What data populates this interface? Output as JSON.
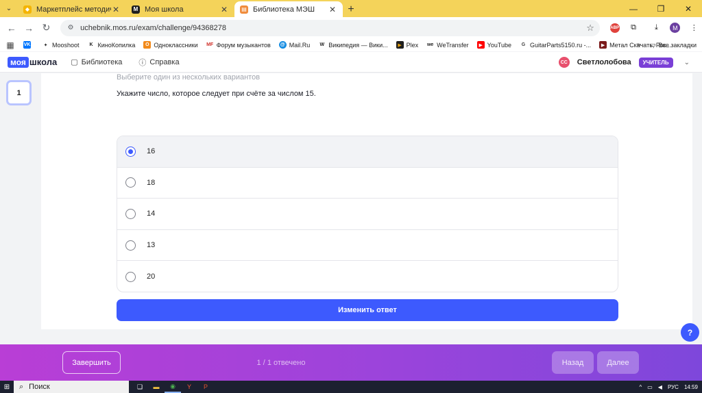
{
  "browser": {
    "tabs": [
      {
        "label": "Маркетплейс методических р",
        "favicon_color": "#f4b400",
        "active": false
      },
      {
        "label": "Моя школа",
        "favicon_color": "#1f1f1f",
        "active": false
      },
      {
        "label": "Библиотека МЭШ",
        "favicon_color": "#f08c3c",
        "active": true
      }
    ],
    "new_tab": "+",
    "url": "uchebnik.mos.ru/exam/challenge/94368278",
    "profile_initial": "M",
    "adblock_label": "ABP"
  },
  "bookmarks": {
    "items": [
      {
        "label": "",
        "icon_color": "#0077ff",
        "icon_text": "VK"
      },
      {
        "label": "Mooshoot",
        "icon_color": "#ffffff",
        "icon_text": "✦"
      },
      {
        "label": "КиноКопилка",
        "icon_color": "#ffffff",
        "icon_text": "K"
      },
      {
        "label": "Одноклассники",
        "icon_color": "#f28a1b",
        "icon_text": "O"
      },
      {
        "label": "Форум музыкантов",
        "icon_color": "#ffffff",
        "icon_text": "MF"
      },
      {
        "label": "Mail.Ru",
        "icon_color": "#168de2",
        "icon_text": "@"
      },
      {
        "label": "Википедия — Вики...",
        "icon_color": "#ffffff",
        "icon_text": "W"
      },
      {
        "label": "Plex",
        "icon_color": "#1f1f1f",
        "icon_text": "▶"
      },
      {
        "label": "WeTransfer",
        "icon_color": "#ffffff",
        "icon_text": "we"
      },
      {
        "label": "YouTube",
        "icon_color": "#ff0000",
        "icon_text": "▶"
      },
      {
        "label": "GuitarParts5150.ru -...",
        "icon_color": "#ffffff",
        "icon_text": "G"
      },
      {
        "label": "Метал Скачать, Рок...",
        "icon_color": "#7b1b1b",
        "icon_text": "▶"
      }
    ],
    "more": "»",
    "all_bookmarks": "Все закладки"
  },
  "header": {
    "logo_moya": "моя",
    "logo_shkola": "школа",
    "nav": [
      {
        "label": "Библиотека",
        "icon": "book-icon"
      },
      {
        "label": "Справка",
        "icon": "help-circle-icon"
      }
    ],
    "user": {
      "initials": "СС",
      "name": "Светлолобова",
      "role": "УЧИТЕЛЬ"
    }
  },
  "question": {
    "number": "1",
    "hint": "Выберите один из нескольких вариантов",
    "text": "Укажите число, которое следует при счёте за числом 15.",
    "options": [
      "16",
      "18",
      "14",
      "13",
      "20"
    ],
    "selected_index": 0,
    "change_answer_label": "Изменить ответ",
    "help_label": "?"
  },
  "footer": {
    "finish_label": "Завершить",
    "progress_text": "1 / 1 отвечено",
    "back_label": "Назад",
    "next_label": "Далее"
  },
  "taskbar": {
    "search_placeholder": "Поиск",
    "lang": "РУС",
    "time": "14:59"
  },
  "colors": {
    "accent": "#3d5afe",
    "tabbar": "#f4d35a",
    "footer_start": "#b93ed6",
    "footer_end": "#7e47db",
    "role_badge": "#7a3fd6"
  }
}
